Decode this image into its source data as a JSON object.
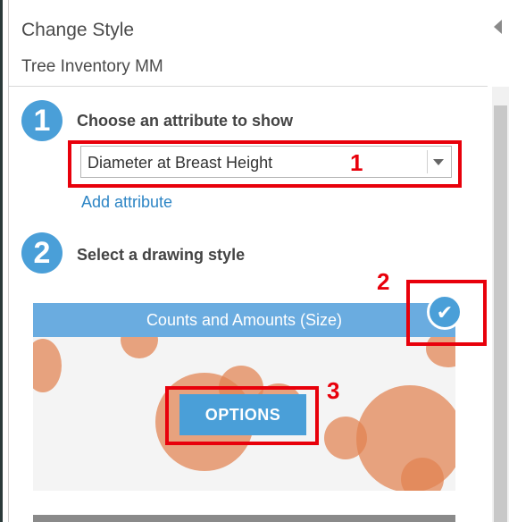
{
  "panel": {
    "title": "Change Style",
    "layer_name": "Tree Inventory MM"
  },
  "step1": {
    "number": "1",
    "label": "Choose an attribute to show",
    "attribute_value": "Diameter at Breast Height",
    "add_attribute": "Add attribute"
  },
  "step2": {
    "number": "2",
    "label": "Select a drawing style",
    "style_card_title": "Counts and Amounts (Size)",
    "options_label": "OPTIONS",
    "selected_icon": "check-icon"
  },
  "annotations": [
    "1",
    "2",
    "3"
  ],
  "colors": {
    "accent": "#4a9fd8",
    "header": "#6aace0",
    "bubble": "#e28250",
    "annotation": "#e8000b",
    "link": "#2d85c5"
  }
}
